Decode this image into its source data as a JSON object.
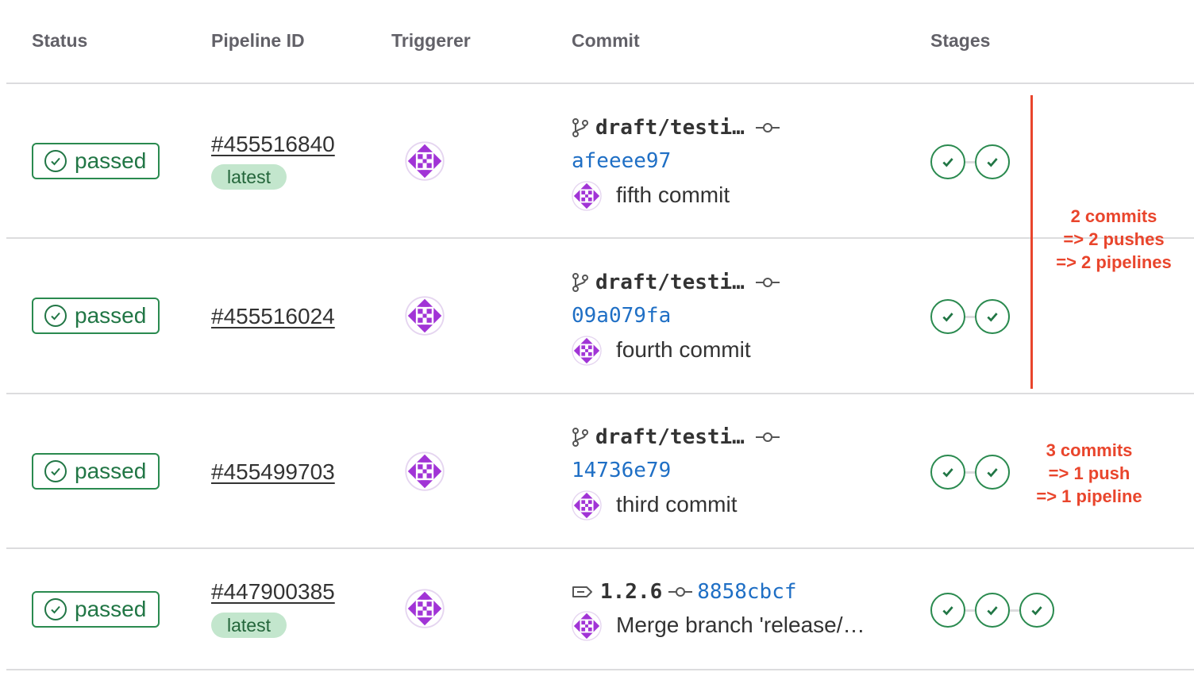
{
  "table": {
    "headers": {
      "status": "Status",
      "pipeline_id": "Pipeline ID",
      "triggerer": "Triggerer",
      "commit": "Commit",
      "stages": "Stages"
    },
    "rows": [
      {
        "status": "passed",
        "pipeline_id": "#455516840",
        "badge": "latest",
        "ref_type": "branch",
        "ref": "draft/testi…",
        "sha": "afeeee97",
        "message": "fifth commit",
        "stages": 2
      },
      {
        "status": "passed",
        "pipeline_id": "#455516024",
        "badge": "",
        "ref_type": "branch",
        "ref": "draft/testi…",
        "sha": "09a079fa",
        "message": "fourth commit",
        "stages": 2
      },
      {
        "status": "passed",
        "pipeline_id": "#455499703",
        "badge": "",
        "ref_type": "branch",
        "ref": "draft/testi…",
        "sha": "14736e79",
        "message": "third commit",
        "stages": 2
      },
      {
        "status": "passed",
        "pipeline_id": "#447900385",
        "badge": "latest",
        "ref_type": "tag",
        "ref": "1.2.6",
        "sha": "8858cbcf",
        "message": "Merge branch 'release/…",
        "stages": 3
      }
    ]
  },
  "annotations": {
    "first": [
      "2 commits",
      "=> 2 pushes",
      "=> 2 pipelines"
    ],
    "second": [
      "3 commits",
      "=> 1 push",
      "=> 1 pipeline"
    ]
  },
  "colors": {
    "success": "#217645",
    "link": "#1f6fc5",
    "annotation": "#e9452c",
    "avatar": "#a134d6"
  }
}
